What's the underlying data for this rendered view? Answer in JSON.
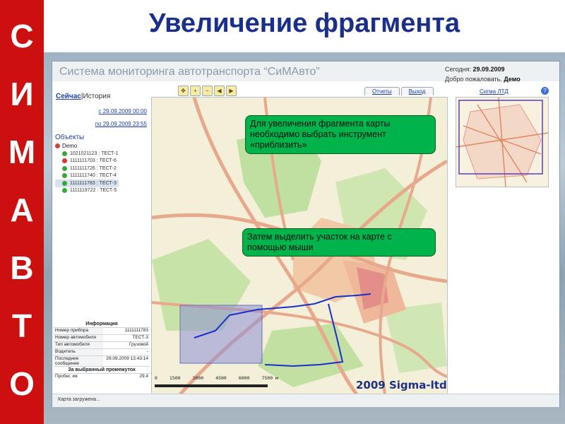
{
  "slide": {
    "title": "Увеличение фрагмента",
    "side_letters": [
      "С",
      "И",
      "М",
      "А",
      "В",
      "Т",
      "О"
    ]
  },
  "app": {
    "title": "Система мониторинга автотранспорта “СиМАвто”",
    "today_label": "Сегодня:",
    "today_value": "29.09.2009",
    "welcome_label": "Добро пожаловать,",
    "welcome_user": "Демо",
    "nav": {
      "now": "Сейчас",
      "separator": "|",
      "history": "История"
    },
    "date_from": "с 29.09.2009 00:00",
    "date_to": "по 29.09.2009 23:55",
    "objects_title": "Объекты",
    "tree": {
      "root": "Demo",
      "items": [
        {
          "label": "1021021123 : ТЕСТ-1",
          "status": "ok"
        },
        {
          "label": "1111111703 : ТЕСТ-6",
          "status": "warn"
        },
        {
          "label": "1111111726 : ТЕСТ-2",
          "status": "ok"
        },
        {
          "label": "1111111740 : ТЕСТ-4",
          "status": "ok"
        },
        {
          "label": "1111111783 : ТЕСТ-3",
          "status": "ok"
        },
        {
          "label": "1111119722 : ТЕСТ-5",
          "status": "ok"
        }
      ]
    },
    "info": {
      "title": "Информация",
      "rows": [
        {
          "k": "Номер прибора",
          "v": "1111111783"
        },
        {
          "k": "Номер автомобиля",
          "v": "ТЕСТ-3"
        },
        {
          "k": "Тип автомобиля",
          "v": "Грузовой"
        },
        {
          "k": "Водитель",
          "v": "-"
        },
        {
          "k": "Последнее сообщение",
          "v": "29.09.2009 13:43:14"
        }
      ],
      "period_title": "За выбранный промежуток",
      "mileage_label": "Пробег, км",
      "mileage_value": "29.4"
    },
    "tabs": [
      "Отчеты",
      "Выход"
    ],
    "minimap_title": "Сигма ЛТД",
    "help_icon": "?",
    "scale_labels": [
      "0",
      "1500",
      "3000",
      "4500",
      "6000",
      "7500 м"
    ],
    "brand": "2009 Sigma-ltd",
    "status": "Карта загружена..."
  },
  "callouts": {
    "zoom_tool": "Для увеличения фрагмента карты необходимо выбрать инструмент «приблизить»",
    "select_area": "Затем выделить участок на карте с помощью мыши"
  },
  "colors": {
    "side_bar": "#cc1010",
    "title": "#1a2f8c",
    "callout": "#00b34a"
  }
}
